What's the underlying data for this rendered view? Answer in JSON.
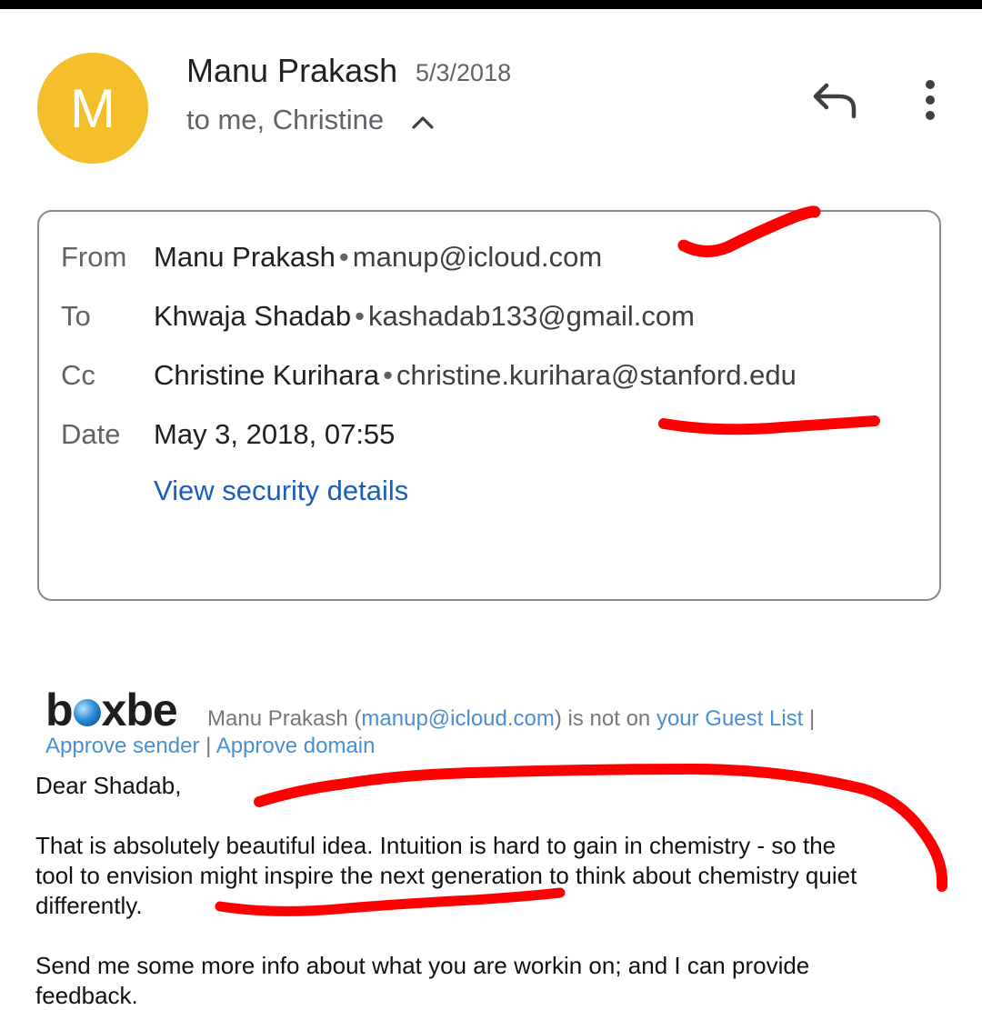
{
  "header": {
    "avatar_letter": "M",
    "avatar_color": "#f4bf2a",
    "sender_name": "Manu Prakash",
    "sent_date": "5/3/2018",
    "recipients_summary": "to me, Christine",
    "icons": [
      "chevron-up-icon",
      "reply-icon",
      "more-vert-icon"
    ]
  },
  "details": {
    "from": {
      "label": "From",
      "name": "Manu Prakash",
      "email": "manup@icloud.com"
    },
    "to": {
      "label": "To",
      "name": "Khwaja Shadab",
      "email": "kashadab133@gmail.com"
    },
    "cc": {
      "label": "Cc",
      "name": "Christine Kurihara",
      "email": "christine.kurihara@stanford.edu"
    },
    "date": {
      "label": "Date",
      "value": "May 3, 2018, 07:55"
    },
    "security_link": "View security details",
    "separator": "•"
  },
  "boxbe": {
    "logo_left": "b",
    "logo_right": "xbe",
    "sender": "Manu Prakash (",
    "sender_email": "manup@icloud.com",
    "not_on_text": ") is not on ",
    "guest_list_link": "your Guest List",
    "pipe": " |",
    "approve_sender": "Approve sender",
    "pipe2": " | ",
    "approve_domain": "Approve domain"
  },
  "body": {
    "greeting": "Dear Shadab,",
    "para1_line1": "That is absolutely beautiful idea. Intuition is hard to gain in chemistry - so the",
    "para1_line2": "tool to envision might inspire the next generation to think about chemistry quiet",
    "para1_line3": "differently.",
    "para2_line1": "Send me some more info about what you are workin on; and I can provide",
    "para2_line2": "feedback."
  },
  "colors": {
    "link": "#1a5dbb",
    "boxbe_link": "#4a8fd4",
    "scribble": "#ff0000"
  }
}
